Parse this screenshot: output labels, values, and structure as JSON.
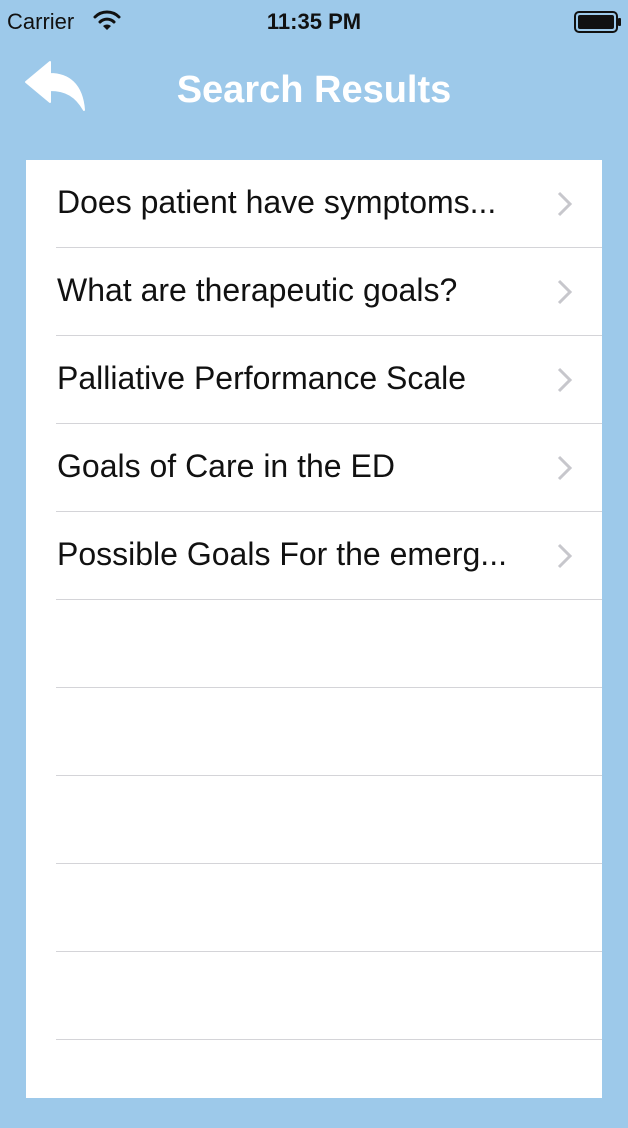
{
  "status_bar": {
    "carrier": "Carrier",
    "time": "11:35 PM"
  },
  "nav": {
    "title": "Search Results",
    "back_icon": "back-arrow-icon"
  },
  "colors": {
    "background": "#9dc9ea",
    "nav_title": "#ffffff",
    "row_text": "#111111",
    "separator": "#d4d4d8",
    "chevron": "#c7c7cc"
  },
  "results": [
    {
      "label": "Does patient have symptoms..."
    },
    {
      "label": "What are therapeutic goals?"
    },
    {
      "label": "Palliative Performance Scale"
    },
    {
      "label": "Goals of Care in the ED"
    },
    {
      "label": "Possible Goals For the emerg..."
    }
  ]
}
